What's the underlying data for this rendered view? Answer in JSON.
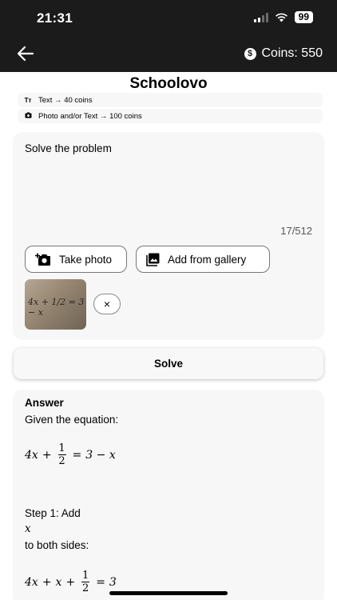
{
  "status_bar": {
    "time": "21:31",
    "battery": "99"
  },
  "header": {
    "coins_label": "Coins: 550"
  },
  "app_title": "Schoolovo",
  "pricing": [
    {
      "icon_text": "Tт",
      "label": "Text → 40 coins"
    },
    {
      "icon_text": "📷",
      "label": "Photo and/or Text → 100 coins"
    }
  ],
  "input_card": {
    "prompt_text": "Solve the problem",
    "counter": "17/512",
    "take_photo_label": "Take photo",
    "gallery_label": "Add from gallery",
    "thumbnail_text": "4x + 1/2 = 3 − x",
    "remove_icon": "×"
  },
  "solve_label": "Solve",
  "answer": {
    "label": "Answer",
    "intro": "Given the equation:",
    "eq1": {
      "lhs_a": "4x",
      "plus": "+",
      "num": "1",
      "den": "2",
      "eq": "=",
      "rhs": "3 − x"
    },
    "step1_a": "Step 1: Add",
    "step1_var": "x",
    "step1_b": " to both sides:",
    "eq2": {
      "lhs_a": "4x",
      "plus1": "+",
      "x": "x",
      "plus2": "+",
      "num": "1",
      "den": "2",
      "eq": "=",
      "rhs": "3"
    }
  },
  "colors": {
    "header_bg": "#1b1b1b",
    "card_bg": "#f7f7f7"
  },
  "icons": [
    "back-arrow-icon",
    "coin-icon",
    "text-icon",
    "camera-icon",
    "camera-add-icon",
    "gallery-icon",
    "close-icon"
  ]
}
